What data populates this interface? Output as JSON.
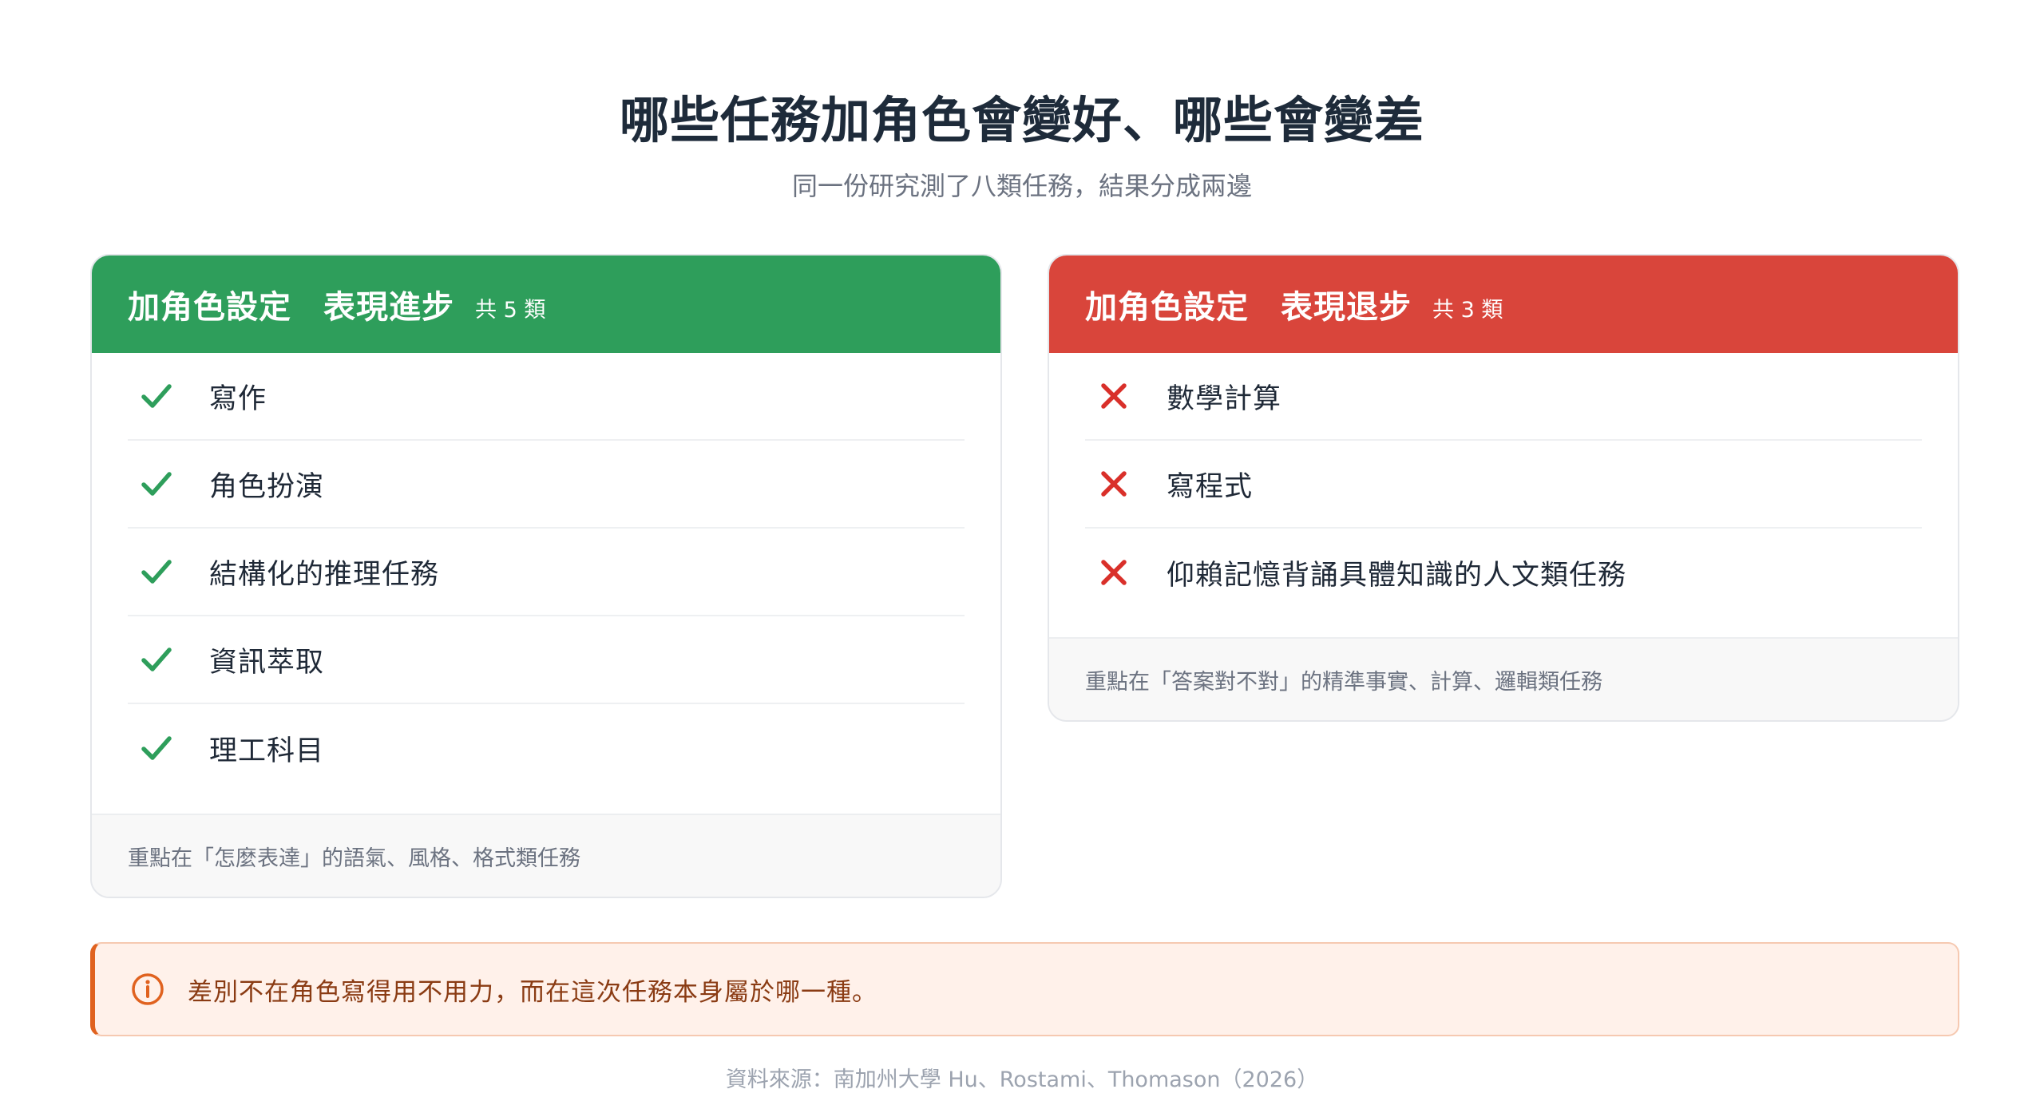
{
  "header": {
    "title": "哪些任務加角色會變好、哪些會變差",
    "subtitle": "同一份研究測了八類任務，結果分成兩邊"
  },
  "better": {
    "title_a": "加角色設定",
    "title_b": "表現進步",
    "count": "共 5 類",
    "color": "#2e9e5b",
    "icon": "check-icon",
    "items": [
      "寫作",
      "角色扮演",
      "結構化的推理任務",
      "資訊萃取",
      "理工科目"
    ],
    "footer": "重點在「怎麼表達」的語氣、風格、格式類任務"
  },
  "worse": {
    "title_a": "加角色設定",
    "title_b": "表現退步",
    "count": "共 3 類",
    "color": "#d9453b",
    "icon": "cross-icon",
    "items": [
      "數學計算",
      "寫程式",
      "仰賴記憶背誦具體知識的人文類任務"
    ],
    "footer": "重點在「答案對不對」的精準事實、計算、邏輯類任務"
  },
  "note": {
    "icon": "info-icon",
    "text": "差別不在角色寫得用不用力，而在這次任務本身屬於哪一種。"
  },
  "source": "資料來源：南加州大學 Hu、Rostami、Thomason（2026）"
}
